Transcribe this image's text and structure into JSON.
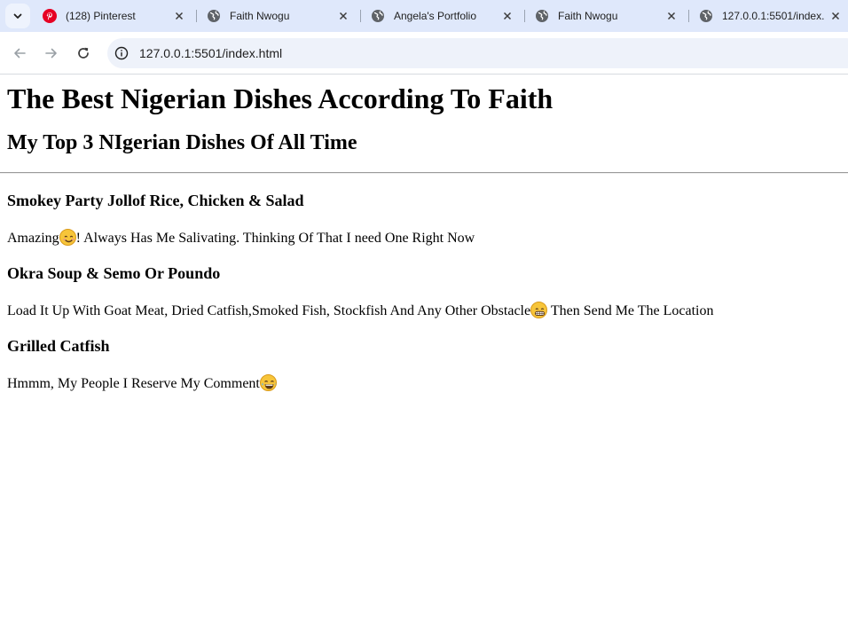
{
  "browser": {
    "tabs": [
      {
        "title": "(128) Pinterest",
        "icon": "pinterest-icon"
      },
      {
        "title": "Faith Nwogu",
        "icon": "globe-icon"
      },
      {
        "title": "Angela's Portfolio",
        "icon": "globe-icon"
      },
      {
        "title": "Faith Nwogu",
        "icon": "globe-icon"
      },
      {
        "title": "127.0.0.1:5501/index.",
        "icon": "globe-icon"
      }
    ],
    "url": "127.0.0.1:5501/index.html",
    "colors": {
      "tabstrip": "#dfe8fb",
      "omnibox": "#eef2fa",
      "pinterest": "#e60023"
    }
  },
  "page": {
    "title": "The Best Nigerian Dishes According To Faith",
    "subtitle": "My Top 3 NIgerian Dishes Of All Time",
    "dishes": [
      {
        "name": "Smokey Party Jollof Rice, Chicken & Salad",
        "desc_before": "Amazing",
        "emoji": "smiling-face-emoji",
        "desc_after": "! Always Has Me Salivating. Thinking Of That I need One Right Now"
      },
      {
        "name": "Okra Soup & Semo Or Poundo",
        "desc_before": "Load It Up With Goat Meat, Dried Catfish,Smoked Fish, Stockfish And Any Other Obstacle",
        "emoji": "grinning-face-emoji",
        "desc_after": " Then Send Me The Location"
      },
      {
        "name": "Grilled Catfish",
        "desc_before": "Hmmm, My People I Reserve My Comment",
        "emoji": "tears-of-joy-emoji",
        "desc_after": ""
      }
    ]
  }
}
